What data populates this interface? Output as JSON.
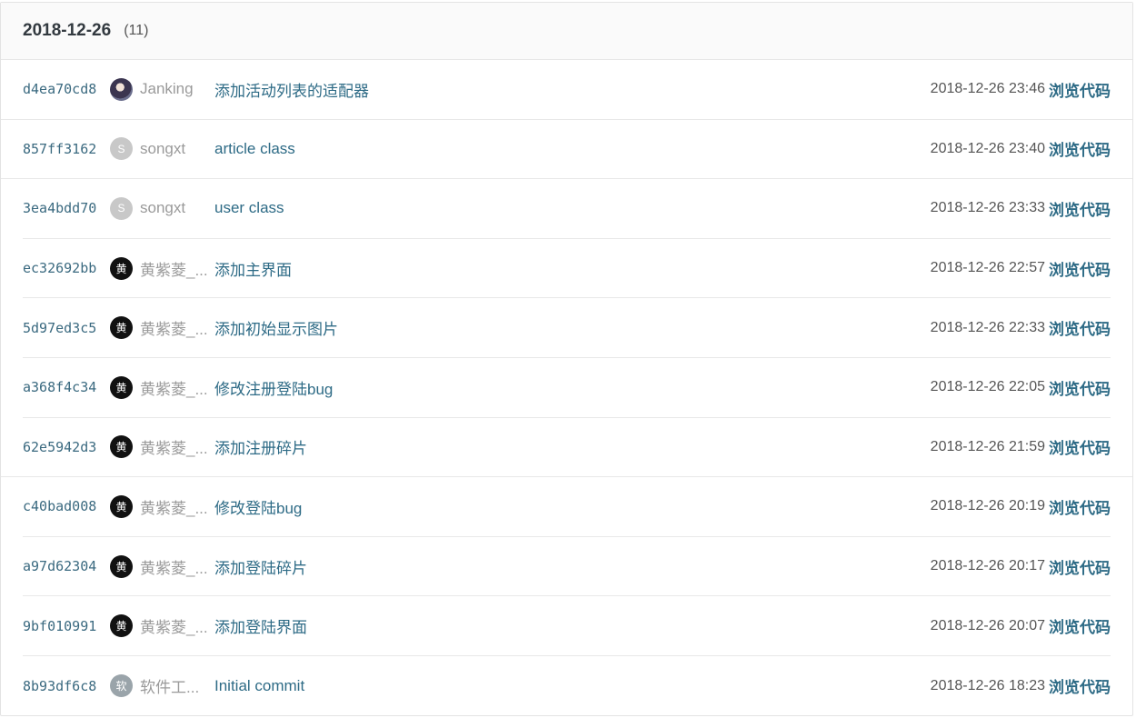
{
  "header": {
    "date": "2018-12-26",
    "count": "(11)"
  },
  "browse_label": "浏览代码",
  "commits": [
    {
      "sha": "d4ea70cd8",
      "avatar": "",
      "author": "Janking",
      "message": "添加活动列表的适配器",
      "time": "2018-12-26 23:46"
    },
    {
      "sha": "857ff3162",
      "avatar": "S",
      "author": "songxt",
      "message": "article class",
      "time": "2018-12-26 23:40"
    },
    {
      "sha": "3ea4bdd70",
      "avatar": "S",
      "author": "songxt",
      "message": "user class",
      "time": "2018-12-26 23:33"
    },
    {
      "sha": "ec32692bb",
      "avatar": "黄",
      "author": "黄紫菱_...",
      "message": "添加主界面",
      "time": "2018-12-26 22:57"
    },
    {
      "sha": "5d97ed3c5",
      "avatar": "黄",
      "author": "黄紫菱_...",
      "message": "添加初始显示图片",
      "time": "2018-12-26 22:33"
    },
    {
      "sha": "a368f4c34",
      "avatar": "黄",
      "author": "黄紫菱_...",
      "message": "修改注册登陆bug",
      "time": "2018-12-26 22:05"
    },
    {
      "sha": "62e5942d3",
      "avatar": "黄",
      "author": "黄紫菱_...",
      "message": "添加注册碎片",
      "time": "2018-12-26 21:59"
    },
    {
      "sha": "c40bad008",
      "avatar": "黄",
      "author": "黄紫菱_...",
      "message": "修改登陆bug",
      "time": "2018-12-26 20:19"
    },
    {
      "sha": "a97d62304",
      "avatar": "黄",
      "author": "黄紫菱_...",
      "message": "添加登陆碎片",
      "time": "2018-12-26 20:17"
    },
    {
      "sha": "9bf010991",
      "avatar": "黄",
      "author": "黄紫菱_...",
      "message": "添加登陆界面",
      "time": "2018-12-26 20:07"
    },
    {
      "sha": "8b93df6c8",
      "avatar": "软",
      "author": "软件工...",
      "message": "Initial commit",
      "time": "2018-12-26 18:23"
    }
  ]
}
